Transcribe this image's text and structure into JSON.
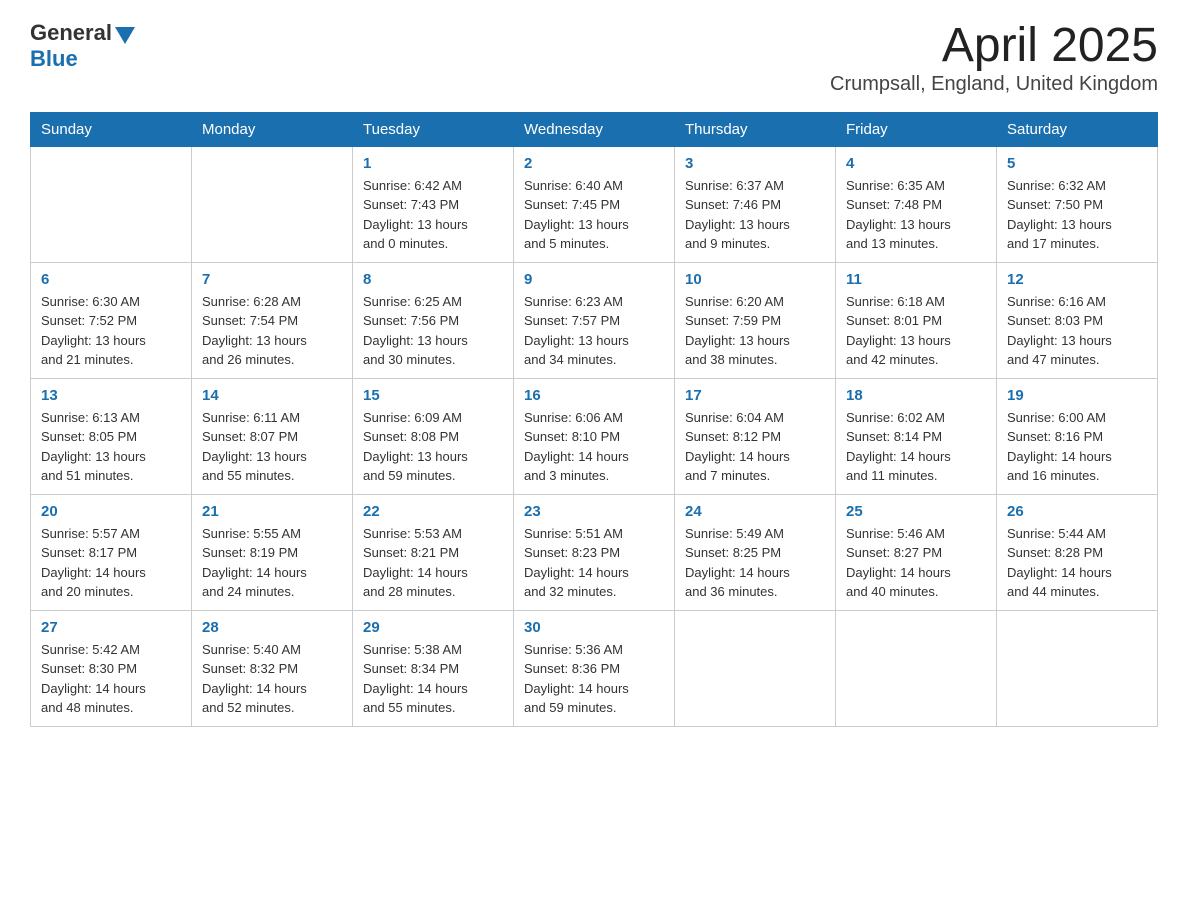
{
  "header": {
    "logo_general": "General",
    "logo_blue": "Blue",
    "title": "April 2025",
    "subtitle": "Crumpsall, England, United Kingdom"
  },
  "columns": [
    "Sunday",
    "Monday",
    "Tuesday",
    "Wednesday",
    "Thursday",
    "Friday",
    "Saturday"
  ],
  "weeks": [
    [
      {
        "day": "",
        "info": ""
      },
      {
        "day": "",
        "info": ""
      },
      {
        "day": "1",
        "info": "Sunrise: 6:42 AM\nSunset: 7:43 PM\nDaylight: 13 hours\nand 0 minutes."
      },
      {
        "day": "2",
        "info": "Sunrise: 6:40 AM\nSunset: 7:45 PM\nDaylight: 13 hours\nand 5 minutes."
      },
      {
        "day": "3",
        "info": "Sunrise: 6:37 AM\nSunset: 7:46 PM\nDaylight: 13 hours\nand 9 minutes."
      },
      {
        "day": "4",
        "info": "Sunrise: 6:35 AM\nSunset: 7:48 PM\nDaylight: 13 hours\nand 13 minutes."
      },
      {
        "day": "5",
        "info": "Sunrise: 6:32 AM\nSunset: 7:50 PM\nDaylight: 13 hours\nand 17 minutes."
      }
    ],
    [
      {
        "day": "6",
        "info": "Sunrise: 6:30 AM\nSunset: 7:52 PM\nDaylight: 13 hours\nand 21 minutes."
      },
      {
        "day": "7",
        "info": "Sunrise: 6:28 AM\nSunset: 7:54 PM\nDaylight: 13 hours\nand 26 minutes."
      },
      {
        "day": "8",
        "info": "Sunrise: 6:25 AM\nSunset: 7:56 PM\nDaylight: 13 hours\nand 30 minutes."
      },
      {
        "day": "9",
        "info": "Sunrise: 6:23 AM\nSunset: 7:57 PM\nDaylight: 13 hours\nand 34 minutes."
      },
      {
        "day": "10",
        "info": "Sunrise: 6:20 AM\nSunset: 7:59 PM\nDaylight: 13 hours\nand 38 minutes."
      },
      {
        "day": "11",
        "info": "Sunrise: 6:18 AM\nSunset: 8:01 PM\nDaylight: 13 hours\nand 42 minutes."
      },
      {
        "day": "12",
        "info": "Sunrise: 6:16 AM\nSunset: 8:03 PM\nDaylight: 13 hours\nand 47 minutes."
      }
    ],
    [
      {
        "day": "13",
        "info": "Sunrise: 6:13 AM\nSunset: 8:05 PM\nDaylight: 13 hours\nand 51 minutes."
      },
      {
        "day": "14",
        "info": "Sunrise: 6:11 AM\nSunset: 8:07 PM\nDaylight: 13 hours\nand 55 minutes."
      },
      {
        "day": "15",
        "info": "Sunrise: 6:09 AM\nSunset: 8:08 PM\nDaylight: 13 hours\nand 59 minutes."
      },
      {
        "day": "16",
        "info": "Sunrise: 6:06 AM\nSunset: 8:10 PM\nDaylight: 14 hours\nand 3 minutes."
      },
      {
        "day": "17",
        "info": "Sunrise: 6:04 AM\nSunset: 8:12 PM\nDaylight: 14 hours\nand 7 minutes."
      },
      {
        "day": "18",
        "info": "Sunrise: 6:02 AM\nSunset: 8:14 PM\nDaylight: 14 hours\nand 11 minutes."
      },
      {
        "day": "19",
        "info": "Sunrise: 6:00 AM\nSunset: 8:16 PM\nDaylight: 14 hours\nand 16 minutes."
      }
    ],
    [
      {
        "day": "20",
        "info": "Sunrise: 5:57 AM\nSunset: 8:17 PM\nDaylight: 14 hours\nand 20 minutes."
      },
      {
        "day": "21",
        "info": "Sunrise: 5:55 AM\nSunset: 8:19 PM\nDaylight: 14 hours\nand 24 minutes."
      },
      {
        "day": "22",
        "info": "Sunrise: 5:53 AM\nSunset: 8:21 PM\nDaylight: 14 hours\nand 28 minutes."
      },
      {
        "day": "23",
        "info": "Sunrise: 5:51 AM\nSunset: 8:23 PM\nDaylight: 14 hours\nand 32 minutes."
      },
      {
        "day": "24",
        "info": "Sunrise: 5:49 AM\nSunset: 8:25 PM\nDaylight: 14 hours\nand 36 minutes."
      },
      {
        "day": "25",
        "info": "Sunrise: 5:46 AM\nSunset: 8:27 PM\nDaylight: 14 hours\nand 40 minutes."
      },
      {
        "day": "26",
        "info": "Sunrise: 5:44 AM\nSunset: 8:28 PM\nDaylight: 14 hours\nand 44 minutes."
      }
    ],
    [
      {
        "day": "27",
        "info": "Sunrise: 5:42 AM\nSunset: 8:30 PM\nDaylight: 14 hours\nand 48 minutes."
      },
      {
        "day": "28",
        "info": "Sunrise: 5:40 AM\nSunset: 8:32 PM\nDaylight: 14 hours\nand 52 minutes."
      },
      {
        "day": "29",
        "info": "Sunrise: 5:38 AM\nSunset: 8:34 PM\nDaylight: 14 hours\nand 55 minutes."
      },
      {
        "day": "30",
        "info": "Sunrise: 5:36 AM\nSunset: 8:36 PM\nDaylight: 14 hours\nand 59 minutes."
      },
      {
        "day": "",
        "info": ""
      },
      {
        "day": "",
        "info": ""
      },
      {
        "day": "",
        "info": ""
      }
    ]
  ]
}
